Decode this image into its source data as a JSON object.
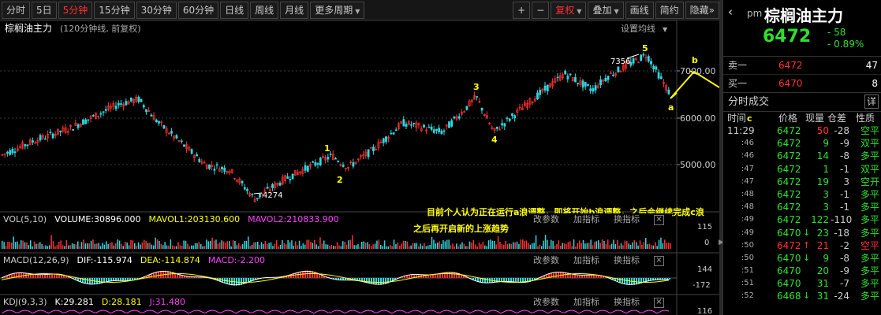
{
  "toolbar": {
    "periods": [
      "分时",
      "5日",
      "5分钟",
      "15分钟",
      "30分钟",
      "60分钟",
      "日线",
      "周线",
      "月线",
      "更多周期"
    ],
    "active_period": 2,
    "right_buttons": [
      "+",
      "−",
      "复权",
      "叠加",
      "画线",
      "简约",
      "隐藏"
    ],
    "more_arrow": "»",
    "dropdown_icon": "▼"
  },
  "chart": {
    "title": "棕榈油主力",
    "subtitle": "(120分钟线, 前复权)",
    "settings_label": "设置均线",
    "price_labels": [
      "7000.00",
      "6000.00",
      "5000.00"
    ],
    "wave_labels": {
      "w1": "1",
      "w2": "2",
      "w3": "3",
      "w4": "4",
      "w5": "5",
      "wa": "a",
      "wb": "b",
      "wc": "c"
    },
    "high_label": "7356",
    "low_label": "4274",
    "annotation_line1": "目前个人认为正在运行a浪调整，即将开始b浪调整，之后会继续完成c浪",
    "annotation_line2": "之后再开启新的上涨趋势",
    "close_icon": "×"
  },
  "chart_data": {
    "type": "candlestick",
    "price_ticks": [
      7000,
      6000,
      5000
    ],
    "low": 4274,
    "high": 7356,
    "waves": [
      {
        "label": "1",
        "approx_price": 5180
      },
      {
        "label": "2",
        "approx_price": 4950
      },
      {
        "label": "3",
        "approx_price": 6450
      },
      {
        "label": "4",
        "approx_price": 5700
      },
      {
        "label": "5",
        "approx_price": 7356
      },
      {
        "label": "a",
        "approx_price": 6472
      },
      {
        "label": "b",
        "approx_price": 7000
      },
      {
        "label": "c",
        "approx_price": 5900
      }
    ]
  },
  "vol": {
    "name": "VOL(5,10)",
    "volume": "VOLUME:30896.000",
    "mavol1": "MAVOL1:203130.600",
    "mavol2": "MAVOL2:210833.900",
    "axis": [
      "115",
      "0"
    ],
    "btns": [
      "改参数",
      "加指标",
      "换指标"
    ]
  },
  "macd": {
    "name": "MACD(12,26,9)",
    "dif": "DIF:-115.974",
    "dea": "DEA:-114.874",
    "macd": "MACD:-2.200",
    "axis": [
      "144",
      "-172"
    ],
    "btns": [
      "改参数",
      "加指标",
      "换指标"
    ]
  },
  "kdj": {
    "name": "KDJ(9,3,3)",
    "k": "K:29.281",
    "d": "D:28.181",
    "j": "J:31.480",
    "axis": [
      "116"
    ],
    "btns": [
      "改参数",
      "加指标",
      "换指标"
    ]
  },
  "right": {
    "back_icon": "‹",
    "pm": "pm",
    "name": "棕榈油主力",
    "price": "6472",
    "change": "- 58",
    "change_pct": "- 0.89%",
    "sell1_label": "卖一",
    "sell1_price": "6472",
    "sell1_vol": "47",
    "buy1_label": "买一",
    "buy1_price": "6470",
    "buy1_vol": "8",
    "trades_title": "分时成交",
    "detail_btn": "详",
    "col_time": "时间",
    "col_price": "价格",
    "col_vol": "现量",
    "col_oi": "仓差",
    "col_nature": "性质",
    "trades": [
      {
        "time": "11:29",
        "price": "6472",
        "arrow": "",
        "vol": "50",
        "oi": "-28",
        "nature": "空平",
        "pc": "dn",
        "vc": "up",
        "nc": "dn",
        "big": true
      },
      {
        "time": ":46",
        "price": "6472",
        "arrow": "",
        "vol": "9",
        "oi": "-9",
        "nature": "双平",
        "pc": "dn",
        "vc": "dn",
        "nc": "dn"
      },
      {
        "time": ":46",
        "price": "6472",
        "arrow": "",
        "vol": "14",
        "oi": "-8",
        "nature": "多平",
        "pc": "dn",
        "vc": "dn",
        "nc": "dn"
      },
      {
        "time": ":47",
        "price": "6472",
        "arrow": "",
        "vol": "1",
        "oi": "-1",
        "nature": "双平",
        "pc": "dn",
        "vc": "dn",
        "nc": "dn"
      },
      {
        "time": ":47",
        "price": "6472",
        "arrow": "",
        "vol": "19",
        "oi": "3",
        "nature": "空开",
        "pc": "dn",
        "vc": "dn",
        "nc": "dn"
      },
      {
        "time": ":48",
        "price": "6472",
        "arrow": "",
        "vol": "3",
        "oi": "-1",
        "nature": "多平",
        "pc": "dn",
        "vc": "dn",
        "nc": "dn"
      },
      {
        "time": ":48",
        "price": "6472",
        "arrow": "",
        "vol": "3",
        "oi": "-1",
        "nature": "多平",
        "pc": "dn",
        "vc": "dn",
        "nc": "dn"
      },
      {
        "time": ":49",
        "price": "6472",
        "arrow": "",
        "vol": "122",
        "oi": "-110",
        "nature": "多平",
        "pc": "dn",
        "vc": "dn",
        "nc": "dn"
      },
      {
        "time": ":49",
        "price": "6470",
        "arrow": "↓",
        "vol": "23",
        "oi": "-18",
        "nature": "多平",
        "pc": "dn",
        "vc": "dn",
        "nc": "dn",
        "ac": "dn"
      },
      {
        "time": ":50",
        "price": "6472",
        "arrow": "↑",
        "vol": "21",
        "oi": "-2",
        "nature": "空平",
        "pc": "up",
        "vc": "up",
        "nc": "up",
        "ac": "up"
      },
      {
        "time": ":50",
        "price": "6470",
        "arrow": "↓",
        "vol": "9",
        "oi": "-8",
        "nature": "多平",
        "pc": "dn",
        "vc": "dn",
        "nc": "dn",
        "ac": "dn"
      },
      {
        "time": ":51",
        "price": "6470",
        "arrow": "",
        "vol": "20",
        "oi": "-9",
        "nature": "多平",
        "pc": "dn",
        "vc": "dn",
        "nc": "dn"
      },
      {
        "time": ":51",
        "price": "6470",
        "arrow": "",
        "vol": "31",
        "oi": "-7",
        "nature": "多平",
        "pc": "dn",
        "vc": "dn",
        "nc": "dn"
      },
      {
        "time": ":52",
        "price": "6468",
        "arrow": "↓",
        "vol": "31",
        "oi": "-24",
        "nature": "多平",
        "pc": "dn",
        "vc": "dn",
        "nc": "dn",
        "ac": "dn"
      }
    ]
  },
  "colors": {
    "up": "#ff3030",
    "down": "#2ee02e",
    "yellow": "#ffff00",
    "cyan": "#2ed8e0",
    "magenta": "#ff40ff",
    "white": "#ffffff"
  }
}
